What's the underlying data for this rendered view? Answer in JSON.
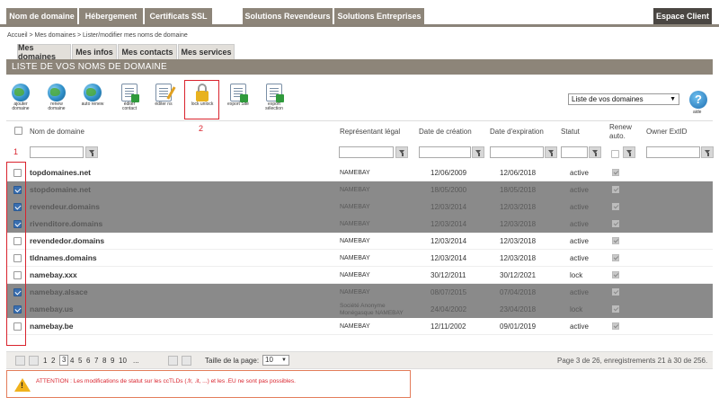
{
  "nav": {
    "left": [
      "Nom de domaine",
      "Hébergement",
      "Certificats SSL"
    ],
    "right": [
      "Solutions Revendeurs",
      "Solutions Entreprises"
    ],
    "account": "Espace Client"
  },
  "breadcrumb": "Accueil > Mes domaines > Lister/modifier mes noms de domaine",
  "subtabs": [
    "Mes domaines",
    "Mes infos",
    "Mes contacts",
    "Mes services"
  ],
  "banner": "LISTE DE VOS NOMS DE DOMAINE",
  "toolbar": [
    {
      "icon": "globe-add-icon",
      "label": "ajouter domaine"
    },
    {
      "icon": "globe-renew-icon",
      "label": "renew domaine"
    },
    {
      "icon": "globe-auto-renew-icon",
      "label": "auto renew"
    },
    {
      "icon": "edit-contact-icon",
      "label": "éditer contact"
    },
    {
      "icon": "edit-ns-icon",
      "label": "éditer ns"
    },
    {
      "icon": "lock-icon",
      "label": "lock unlock"
    },
    {
      "icon": "export-site-icon",
      "label": "export Site"
    },
    {
      "icon": "export-selection-icon",
      "label": "export sélection"
    }
  ],
  "annotations": {
    "lock": "2",
    "checkboxes": "1"
  },
  "list_select": "Liste de vos domaines",
  "help_label": "aide",
  "columns": {
    "domain": "Nom de domaine",
    "rep": "Représentant légal",
    "created": "Date de création",
    "expires": "Date d'expiration",
    "status": "Statut",
    "renew": "Renew auto.",
    "owner": "Owner ExtID"
  },
  "rows": [
    {
      "domain": "topdomaines.net",
      "rep": "NAMEBAY",
      "created": "12/06/2009",
      "expires": "12/06/2018",
      "status": "active",
      "selected": false
    },
    {
      "domain": "stopdomaine.net",
      "rep": "NAMEBAY",
      "created": "18/05/2000",
      "expires": "18/05/2018",
      "status": "active",
      "selected": true
    },
    {
      "domain": "revendeur.domains",
      "rep": "NAMEBAY",
      "created": "12/03/2014",
      "expires": "12/03/2018",
      "status": "active",
      "selected": true
    },
    {
      "domain": "rivenditore.domains",
      "rep": "NAMEBAY",
      "created": "12/03/2014",
      "expires": "12/03/2018",
      "status": "active",
      "selected": true
    },
    {
      "domain": "revendedor.domains",
      "rep": "NAMEBAY",
      "created": "12/03/2014",
      "expires": "12/03/2018",
      "status": "active",
      "selected": false
    },
    {
      "domain": "tldnames.domains",
      "rep": "NAMEBAY",
      "created": "12/03/2014",
      "expires": "12/03/2018",
      "status": "active",
      "selected": false
    },
    {
      "domain": "namebay.xxx",
      "rep": "NAMEBAY",
      "created": "30/12/2011",
      "expires": "30/12/2021",
      "status": "lock",
      "selected": false
    },
    {
      "domain": "namebay.alsace",
      "rep": "NAMEBAY",
      "created": "08/07/2015",
      "expires": "07/04/2018",
      "status": "active",
      "selected": true
    },
    {
      "domain": "namebay.us",
      "rep": "Société Anonyme Monégasque NAMEBAY",
      "created": "24/04/2002",
      "expires": "23/04/2018",
      "status": "lock",
      "selected": true
    },
    {
      "domain": "namebay.be",
      "rep": "NAMEBAY",
      "created": "12/11/2002",
      "expires": "09/01/2019",
      "status": "active",
      "selected": false
    }
  ],
  "pager": {
    "pages": [
      "1",
      "2",
      "3",
      "4",
      "5",
      "6",
      "7",
      "8",
      "9",
      "10",
      "..."
    ],
    "current": "3",
    "page_size_label": "Taille de la page:",
    "page_size": "10",
    "summary": "Page 3 de 26, enregistrements 21 à 30 de 256."
  },
  "warning": "ATTENTION : Les modifications de statut sur les ccTLDs (.fr, .it, ...) et les .EU ne sont pas possibles."
}
